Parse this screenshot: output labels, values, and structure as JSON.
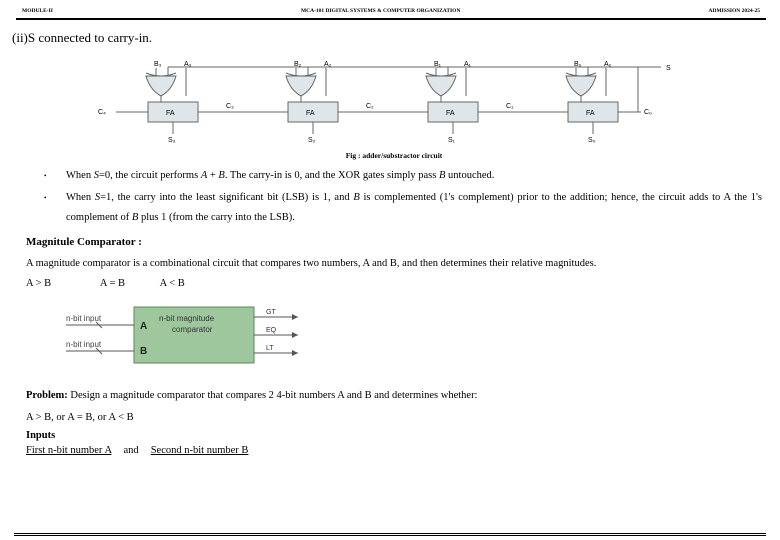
{
  "header": {
    "left": "MODULE-II",
    "center": "MCA-101 DIGITAL SYSTEMS & COMPUTER ORGANIZATION",
    "right": "ADMISSION 2024-25"
  },
  "subsection": "(ii)S connected to carry-in.",
  "circuit": {
    "top_labels": [
      "B₃",
      "A₃",
      "B₂",
      "A₂",
      "B₁",
      "A₁",
      "B₀",
      "A₀"
    ],
    "s_label": "S",
    "fa_label": "FA",
    "c_labels": [
      "C₄",
      "C₃",
      "C₂",
      "C₁",
      "C₀"
    ],
    "sum_labels": [
      "S₃",
      "S₂",
      "S₁",
      "S₀"
    ]
  },
  "fig_caption": "Fig : adder/substractor circuit",
  "bullets": [
    {
      "prefix": "When ",
      "svar": "S",
      "text1": "=0, the circuit performs ",
      "Avar": "A",
      "plus": " + ",
      "Bvar": "B",
      "text2": ". The carry-in is 0, and the XOR gates simply pass ",
      "Bvar2": "B",
      "text3": " untouched."
    },
    {
      "prefix": "When ",
      "svar": "S",
      "text1": "=1, the carry into the least significant bit (LSB) is 1, and ",
      "Bvar": "B",
      "text2": " is complemented (1's  complement) prior to the addition; hence, the circuit adds to A the 1's complement of ",
      "Bvar2": "B",
      "text3": " plus 1 (from the carry into the LSB)."
    }
  ],
  "comparator": {
    "heading": "Magnitule Comparator :",
    "desc": "  A magnitude comparator is a combinational circuit that compares two numbers, A and B, and then  determines their relative magnitudes.",
    "rels": {
      "a": "A > B",
      "b": "A = B",
      "c": "A < B"
    },
    "block": {
      "in_a": "n-bit input",
      "in_b": "n-bit input",
      "A": "A",
      "B": "B",
      "title1": "n-bit magnitude",
      "title2": "comparator",
      "out_gt": "GT",
      "out_eq": "EQ",
      "out_lt": "LT"
    }
  },
  "problem": {
    "label": "Problem:",
    "text": " Design a magnitude comparator that compares 2 4-bit numbers A and B and determines  whether:",
    "line2": "A > B, or  A = B, or  A < B"
  },
  "inputs": {
    "heading": "Inputs",
    "first": "First n-bit number A",
    "and": "and",
    "second": "Second n-bit number B"
  }
}
